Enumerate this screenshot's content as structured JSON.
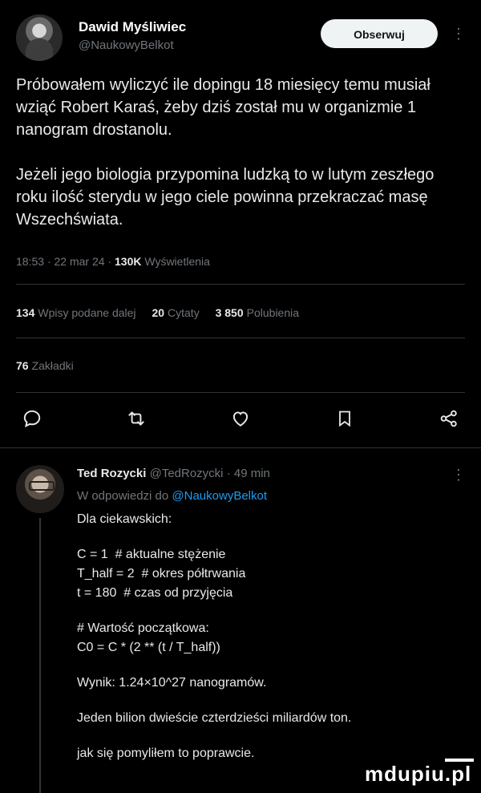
{
  "tweet": {
    "author_name": "Dawid Myśliwiec",
    "author_handle": "@NaukowyBelkot",
    "follow_label": "Obserwuj",
    "paragraphs": [
      "Próbowałem wyliczyć ile dopingu 18 miesięcy temu musiał wziąć Robert Karaś, żeby dziś został mu w organizmie 1 nanogram drostanolu.",
      "Jeżeli jego biologia przypomina ludzką to w lutym zeszłego roku ilość sterydu w jego ciele powinna przekraczać masę Wszechświata."
    ],
    "time": "18:53",
    "date": "22 mar 24",
    "views_count": "130K",
    "views_label": "Wyświetlenia",
    "reposts_count": "134",
    "reposts_label": "Wpisy podane dalej",
    "quotes_count": "20",
    "quotes_label": "Cytaty",
    "likes_count": "3 850",
    "likes_label": "Polubienia",
    "bookmarks_count": "76",
    "bookmarks_label": "Zakładki"
  },
  "reply": {
    "name": "Ted Rozycki",
    "handle": "@TedRozycki",
    "age": "49 min",
    "replying_prefix": "W odpowiedzi do",
    "replying_handle": "@NaukowyBelkot",
    "lines": {
      "l1": "Dla ciekawskich:",
      "l2": "C = 1  # aktualne stężenie",
      "l3": "T_half = 2  # okres półtrwania",
      "l4": "t = 180  # czas od przyjęcia",
      "l5": "# Wartość początkowa:",
      "l6": "C0 = C * (2 ** (t / T_half))",
      "l7": "Wynik: 1.24×10^27 nanogramów.",
      "l8": "Jeden bilion dwieście czterdzieści miliardów ton.",
      "l9": "jak się pomyliłem to poprawcie."
    }
  },
  "watermark": "mdupiu.pl",
  "colors": {
    "background": "#000000",
    "text": "#e7e9ea",
    "muted": "#71767b",
    "link": "#1d9bf0",
    "divider": "#2f3336",
    "follow_bg": "#eff3f4"
  },
  "icons": [
    "reply-icon",
    "repost-icon",
    "like-icon",
    "bookmark-icon",
    "share-icon",
    "more-icon"
  ]
}
